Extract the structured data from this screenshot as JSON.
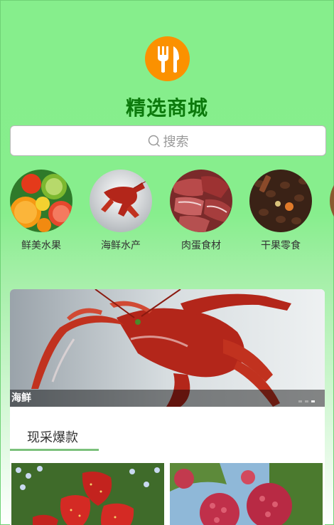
{
  "header": {
    "logo_icon": "fork-knife-icon",
    "logo_color": "#fb9100",
    "title": "精选商城",
    "title_color": "#0c7a0c"
  },
  "search": {
    "icon": "search-icon",
    "placeholder": "搜索"
  },
  "categories": [
    {
      "label": "鲜美水果",
      "image": "fruits-image"
    },
    {
      "label": "海鲜水产",
      "image": "lobster-image"
    },
    {
      "label": "肉蛋食材",
      "image": "meat-image"
    },
    {
      "label": "干果零食",
      "image": "nuts-image"
    }
  ],
  "banner": {
    "caption": "海鲜",
    "slide_count": 3,
    "active_slide": 3
  },
  "section": {
    "title": "现采爆款",
    "products": [
      {
        "image": "strawberry-image"
      },
      {
        "image": "raspberry-image"
      }
    ]
  }
}
